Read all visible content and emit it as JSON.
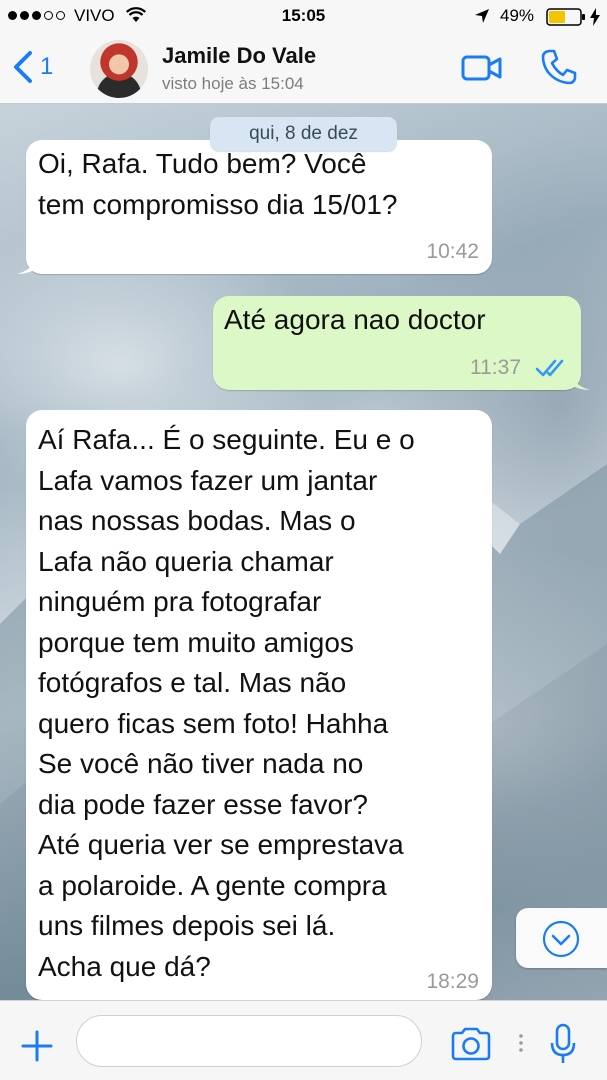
{
  "status_bar": {
    "carrier": "VIVO",
    "time": "15:05",
    "battery": "49%",
    "signal_bars_filled": 3,
    "signal_bars_total": 5
  },
  "header": {
    "back_count": "1",
    "contact_name": "Jamile Do Vale",
    "last_seen": "visto hoje às 15:04",
    "icons": [
      "chevron-left-icon",
      "video-camera-icon",
      "phone-icon"
    ]
  },
  "chat": {
    "date_separator": "qui, 8 de dez",
    "messages": [
      {
        "direction": "incoming",
        "text": "Oi, Rafa. Tudo bem? Você\ntem compromisso dia 15/01?",
        "time": "10:42"
      },
      {
        "direction": "outgoing",
        "text": "Até agora nao doctor",
        "time": "11:37",
        "status": "read"
      },
      {
        "direction": "incoming",
        "text": "Aí Rafa... É o seguinte. Eu e o\nLafa vamos fazer um jantar\nnas nossas bodas. Mas o\nLafa não queria chamar\nninguém pra fotografar\nporque tem muito amigos\nfotógrafos e tal. Mas não\nquero ficas sem foto! Hahha\nSe você não tiver nada no\ndia pode fazer esse favor?\nAté queria ver se emprestava\na polaroide. A gente compra\nuns filmes depois sei lá.\nAcha que dá?",
        "time": "18:29"
      }
    ]
  },
  "input_bar": {
    "placeholder": "",
    "value": "",
    "icons": [
      "plus-icon",
      "camera-icon",
      "microphone-icon"
    ]
  },
  "colors": {
    "accent": "#1a7cf5",
    "outgoing_bubble": "#dcf8c6",
    "incoming_bubble": "#ffffff",
    "date_pill": "#d8e6f3",
    "read_ticks": "#3497f9"
  }
}
